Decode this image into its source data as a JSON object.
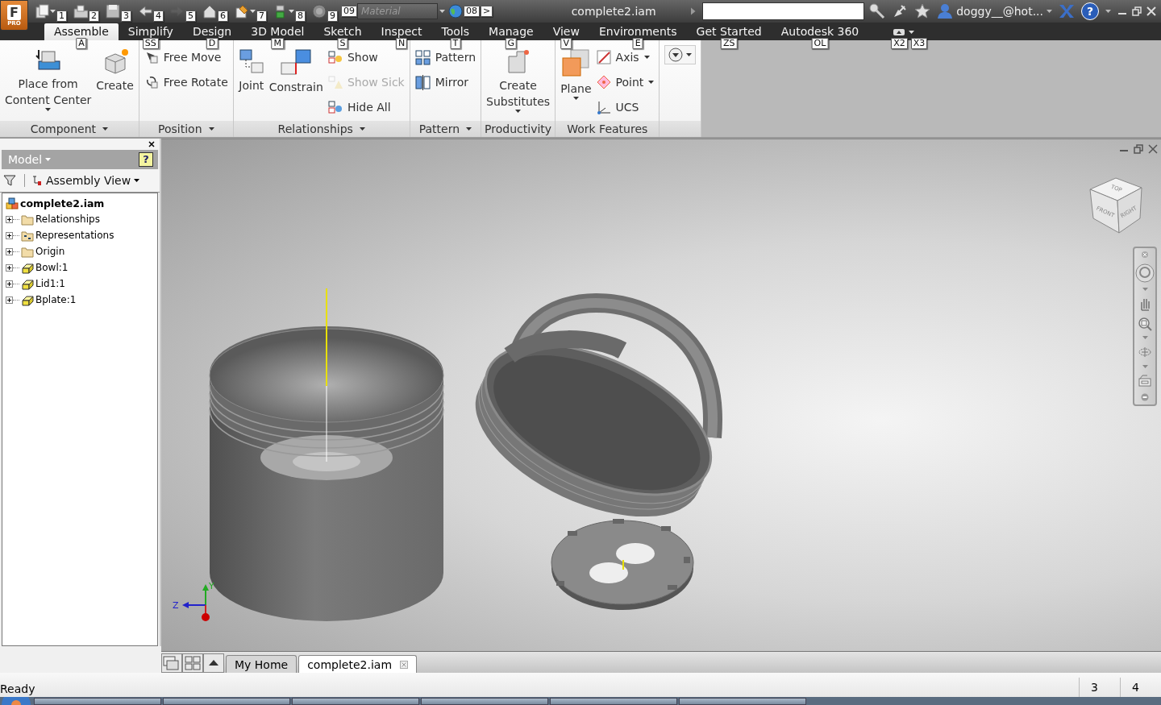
{
  "title_bar": {
    "app_button": {
      "label": "F",
      "edition": "PRO"
    },
    "quick_access": [
      {
        "keytip": "1",
        "dropdown": true,
        "disabled": false
      },
      {
        "keytip": "2",
        "dropdown": false,
        "disabled": false
      },
      {
        "keytip": "3",
        "dropdown": false,
        "disabled": false
      },
      {
        "keytip": "4",
        "dropdown": false,
        "disabled": false
      },
      {
        "keytip": "5",
        "dropdown": false,
        "disabled": true
      },
      {
        "keytip": "6",
        "dropdown": false,
        "disabled": false
      },
      {
        "keytip": "7",
        "dropdown": true,
        "disabled": false
      },
      {
        "keytip": "8",
        "dropdown": true,
        "disabled": false
      },
      {
        "keytip": "9",
        "dropdown": false,
        "disabled": false
      }
    ],
    "material": {
      "keytip": "09",
      "placeholder": "Material"
    },
    "globe": {
      "keytip": "08"
    },
    "overflow_keytip": ">",
    "title": "complete2.iam",
    "user": "doggy__@hot...",
    "help_icon": "?"
  },
  "ribbon_tabs": [
    {
      "label": "Assemble",
      "keytip": "A",
      "selected": true
    },
    {
      "label": "Simplify",
      "keytip": "SS",
      "selected": false
    },
    {
      "label": "Design",
      "keytip": "D",
      "selected": false
    },
    {
      "label": "3D Model",
      "keytip": "M",
      "selected": false
    },
    {
      "label": "Sketch",
      "keytip": "S",
      "selected": false
    },
    {
      "label": "Inspect",
      "keytip": "N",
      "selected": false
    },
    {
      "label": "Tools",
      "keytip": "T",
      "selected": false
    },
    {
      "label": "Manage",
      "keytip": "G",
      "selected": false
    },
    {
      "label": "View",
      "keytip": "V",
      "selected": false
    },
    {
      "label": "Environments",
      "keytip": "E",
      "selected": false
    },
    {
      "label": "Get Started",
      "keytip": "ZS",
      "selected": false
    },
    {
      "label": "Autodesk 360",
      "keytip": "OL",
      "selected": false
    }
  ],
  "ribbon_extra_keytips": [
    "X2",
    "X3"
  ],
  "ribbon_panels": [
    {
      "title": "Component",
      "menu": true,
      "tools": [
        {
          "kind": "large",
          "lines": [
            "Place from",
            "Content Center"
          ],
          "dropdown": true,
          "disabled": false
        },
        {
          "kind": "large",
          "lines": [
            "Create"
          ],
          "dropdown": false,
          "disabled": false
        }
      ]
    },
    {
      "title": "Position",
      "menu": true,
      "tools": [
        {
          "kind": "small",
          "lines": [
            "Free Move"
          ],
          "dropdown": false,
          "disabled": false
        },
        {
          "kind": "small",
          "lines": [
            "Free Rotate"
          ],
          "dropdown": false,
          "disabled": false
        }
      ]
    },
    {
      "title": "Relationships",
      "menu": true,
      "tools": [
        {
          "kind": "large",
          "lines": [
            "Joint"
          ],
          "dropdown": false,
          "disabled": false
        },
        {
          "kind": "large",
          "lines": [
            "Constrain"
          ],
          "dropdown": false,
          "disabled": false
        },
        {
          "kind": "small",
          "lines": [
            "Show"
          ],
          "dropdown": false,
          "disabled": false
        },
        {
          "kind": "small",
          "lines": [
            "Show Sick"
          ],
          "dropdown": false,
          "disabled": true
        },
        {
          "kind": "small",
          "lines": [
            "Hide All"
          ],
          "dropdown": false,
          "disabled": false
        }
      ]
    },
    {
      "title": "Pattern",
      "menu": true,
      "tools": [
        {
          "kind": "small",
          "lines": [
            "Pattern"
          ],
          "dropdown": false,
          "disabled": false
        },
        {
          "kind": "small",
          "lines": [
            "Mirror"
          ],
          "dropdown": false,
          "disabled": false
        }
      ]
    },
    {
      "title": "Productivity",
      "menu": false,
      "tools": [
        {
          "kind": "large",
          "lines": [
            "Create",
            "Substitutes"
          ],
          "dropdown": true,
          "disabled": false
        }
      ]
    },
    {
      "title": "Work Features",
      "menu": false,
      "tools": [
        {
          "kind": "large",
          "lines": [
            "Plane"
          ],
          "dropdown": true,
          "disabled": false
        },
        {
          "kind": "small",
          "lines": [
            "Axis"
          ],
          "dropdown": true,
          "disabled": false
        },
        {
          "kind": "small",
          "lines": [
            "Point"
          ],
          "dropdown": true,
          "disabled": false
        },
        {
          "kind": "small",
          "lines": [
            "UCS"
          ],
          "dropdown": false,
          "disabled": false
        }
      ]
    },
    {
      "menu": false,
      "tools": [
        {
          "kind": "more",
          "dropdown": true,
          "disabled": false
        }
      ]
    }
  ],
  "browser": {
    "title": "Model",
    "view": "Assembly View",
    "help_icon": "?",
    "tree": [
      {
        "label": "complete2.iam",
        "kind": "assembly",
        "children": [
          {
            "label": "Relationships",
            "kind": "folder",
            "expanded": false
          },
          {
            "label": "Representations",
            "kind": "representations",
            "expanded": false
          },
          {
            "label": "Origin",
            "kind": "folder",
            "expanded": false
          },
          {
            "label": "Bowl:1",
            "kind": "part",
            "expanded": false
          },
          {
            "label": "Lid1:1",
            "kind": "part",
            "expanded": false
          },
          {
            "label": "Bplate:1",
            "kind": "part",
            "expanded": false
          }
        ]
      }
    ]
  },
  "viewport": {
    "view_cube": {
      "top": "TOP",
      "front": "FRONT",
      "right": "RIGHT"
    },
    "axes": {
      "y": "Y",
      "z": "Z"
    }
  },
  "document_tabs": [
    {
      "label": "My Home",
      "selected": false
    },
    {
      "label": "complete2.iam",
      "selected": true
    }
  ],
  "status_bar": {
    "message": "Ready",
    "cells": [
      "3",
      "4"
    ]
  }
}
